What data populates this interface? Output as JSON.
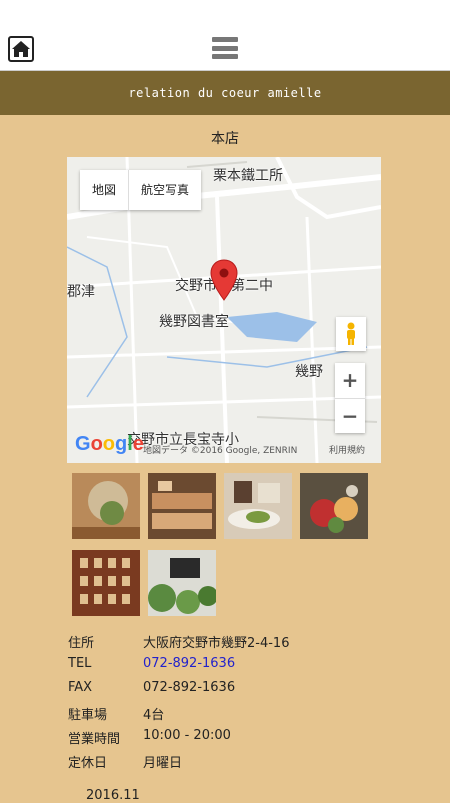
{
  "header": {
    "home_icon": "home-icon",
    "menu_icon": "hamburger-menu-icon"
  },
  "brand": {
    "text": "relation du coeur amielle"
  },
  "store": {
    "title": "本店"
  },
  "map": {
    "tabs": [
      "地図",
      "航空写真"
    ],
    "labels": {
      "factory": "栗本鐵工所",
      "school": "交野市立第二中",
      "library": "幾野図書室",
      "area1": "幾野",
      "area2": "郡津",
      "elementary": "交野市立長宝寺小",
      "attribution": "地図データ ©2016 Google, ZENRIN",
      "terms": "利用規約"
    },
    "google": "Google",
    "zoom_in": "+",
    "zoom_out": "−"
  },
  "info": {
    "address_label": "住所",
    "address": "大阪府交野市幾野2-4-16",
    "tel_label": "TEL",
    "tel": "072-892-1636",
    "fax_label": "FAX",
    "fax": "072-892-1636",
    "parking_label": "駐車場",
    "parking": "4台",
    "hours_label": "営業時間",
    "hours": "10:00 - 20:00",
    "closed_label": "定休日",
    "closed": "月曜日"
  },
  "date": "2016.11"
}
